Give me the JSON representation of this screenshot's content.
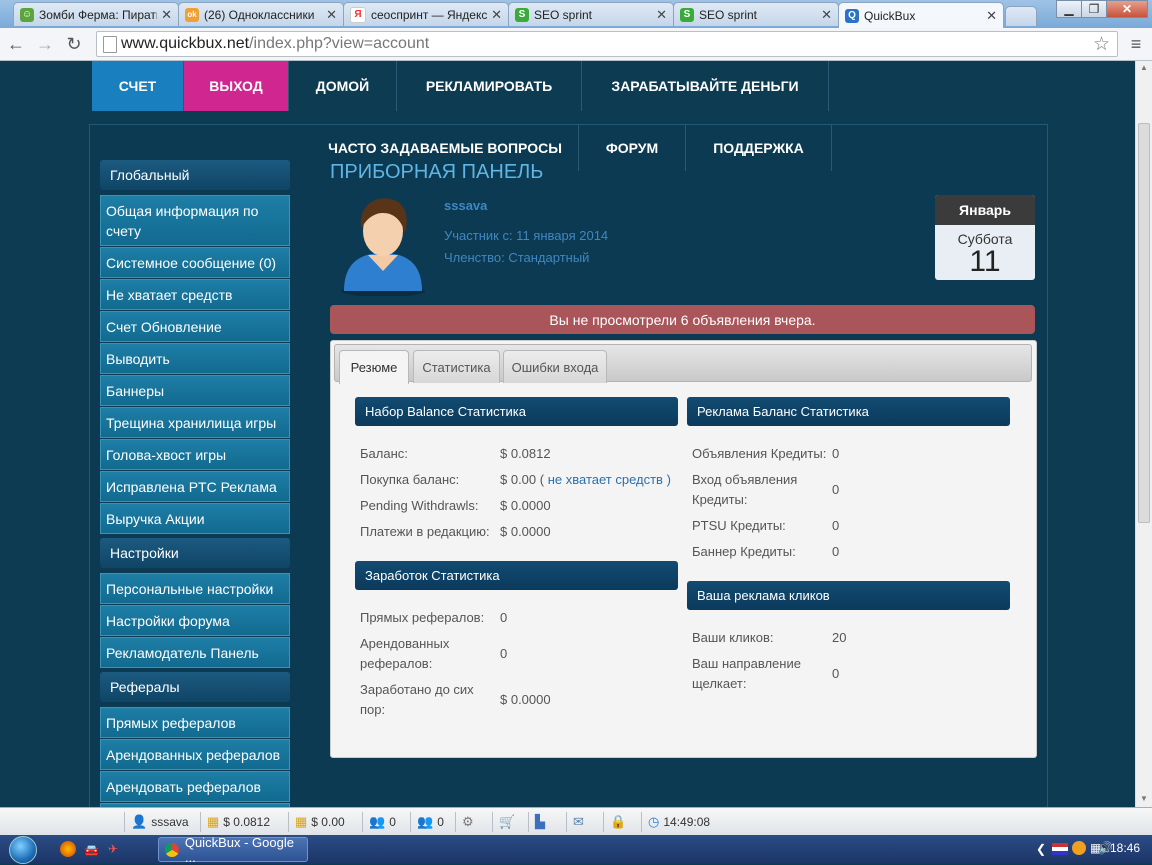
{
  "browser": {
    "tabs": [
      {
        "title": "Зомби Ферма: Пираты",
        "color": "#5aa53c",
        "glyph": "☺"
      },
      {
        "title": "(26) Одноклассники",
        "color": "#f0a030",
        "glyph": "ok"
      },
      {
        "title": "сеоспринт — Яндекс:",
        "color": "#e33",
        "glyph": "Я"
      },
      {
        "title": "SEO sprint",
        "color": "#3aaa3a",
        "glyph": "S"
      },
      {
        "title": "SEO sprint",
        "color": "#3aaa3a",
        "glyph": "S"
      },
      {
        "title": "QuickBux",
        "color": "#2a72c8",
        "glyph": "Q"
      }
    ],
    "url_host": "www.quickbux.net",
    "url_path": "/index.php?view=account"
  },
  "topnav": {
    "items": [
      "СЧЕТ",
      "ВЫХОД",
      "ДОМОЙ",
      "РЕКЛАМИРОВАТЬ",
      "ЗАРАБАТЫВАЙТЕ ДЕНЬГИ"
    ],
    "row2": [
      "ЧАСТО ЗАДАВАЕМЫЕ ВОПРОСЫ",
      "ФОРУМ",
      "ПОДДЕРЖКА"
    ],
    "active_color": "#1a7fbf",
    "logout_color": "#d0268f"
  },
  "sidebar": {
    "global_head": "Глобальный",
    "global_items": [
      "Общая информация по счету",
      "Системное сообщение (0)",
      "Не хватает средств",
      "Счет Обновление",
      "Выводить",
      "Баннеры",
      "Трещина хранилища игры",
      "Голова-хвост игры",
      "Исправлена PTC Реклама",
      "Выручка Акции"
    ],
    "settings_head": "Настройки",
    "settings_items": [
      "Персональные настройки",
      "Настройки форума",
      "Рекламодатель Панель"
    ],
    "referrals_head": "Рефералы",
    "referrals_items": [
      "Прямых рефералов",
      "Арендованных рефералов",
      "Арендовать рефералов"
    ]
  },
  "dashboard": {
    "title": "ПРИБОРНАЯ ПАНЕЛЬ",
    "username": "sssava",
    "member_since": "Участник с: 11 января 2014",
    "membership": "Членство: Стандартный",
    "calendar": {
      "month": "Январь",
      "weekday": "Суббота",
      "day": "11"
    },
    "alert": "Вы не просмотрели 6 объявления вчера."
  },
  "panel": {
    "tabs": [
      "Резюме",
      "Статистика",
      "Ошибки входа"
    ],
    "balance": {
      "head": "Набор Balance Статистика",
      "rows": [
        {
          "label": "Баланс:",
          "value": "$ 0.0812"
        },
        {
          "label": "Покупка баланс:",
          "value": "$ 0.00 (",
          "link": "не хватает средств",
          "after": " )"
        },
        {
          "label": "Pending Withdrawls:",
          "value": "$ 0.0000"
        },
        {
          "label": "Платежи в редакцию:",
          "value": "$ 0.0000"
        }
      ]
    },
    "earnings": {
      "head": "Заработок Статистика",
      "rows": [
        {
          "label": "Прямых рефералов:",
          "value": "0"
        },
        {
          "label": "Арендованных рефералов:",
          "value": "0"
        },
        {
          "label": "Заработано до сих пор:",
          "value": "$ 0.0000"
        }
      ]
    },
    "ad_balance": {
      "head": "Реклама Баланс Статистика",
      "rows": [
        {
          "label": "Объявления Кредиты:",
          "value": "0"
        },
        {
          "label": "Вход объявления Кредиты:",
          "value": "0"
        },
        {
          "label": "PTSU Кредиты:",
          "value": "0"
        },
        {
          "label": "Баннер Кредиты:",
          "value": "0"
        }
      ]
    },
    "clicks": {
      "head": "Ваша реклама кликов",
      "rows": [
        {
          "label": "Ваши кликов:",
          "value": "20"
        },
        {
          "label": "Ваш направление щелкает:",
          "value": "0"
        }
      ]
    }
  },
  "qbbar": {
    "user": "sssava",
    "balance": "$ 0.0812",
    "purchase": "$ 0.00",
    "direct_refs": "0",
    "rented_refs": "0",
    "time": "14:49:08"
  },
  "taskbar": {
    "app": "QuickBux - Google ...",
    "clock": "18:46"
  }
}
